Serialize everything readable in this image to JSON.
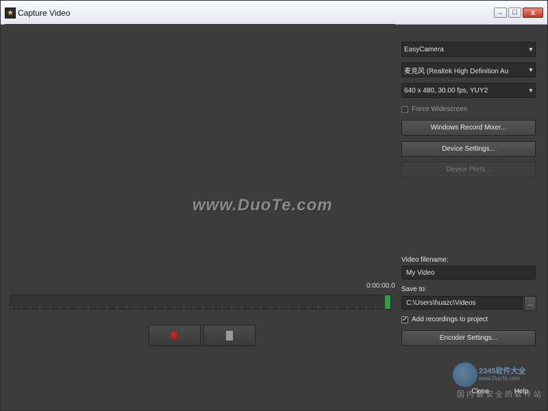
{
  "window": {
    "title": "Capture Video",
    "controls": {
      "minimize": "–",
      "maximize": "☐",
      "close": "X"
    }
  },
  "preview": {
    "watermark": "www.DuoTe.com",
    "timecode": "0:00:00.0"
  },
  "devices": {
    "video_device": "EasyCamera",
    "audio_device": "麦克风 (Realtek High Definition Au",
    "format": "640 x 480, 30.00 fps, YUY2",
    "force_widescreen_label": "Force Widescreen",
    "force_widescreen_checked": false,
    "record_mixer_label": "Windows Record Mixer...",
    "device_settings_label": "Device Settings...",
    "device_ports_label": "Device Ports..."
  },
  "output": {
    "filename_label": "Video filename:",
    "filename_value": "My Video",
    "save_to_label": "Save to:",
    "save_to_value": "C:\\Users\\huazc\\Videos",
    "browse_label": "...",
    "add_to_project_label": "Add recordings to project",
    "add_to_project_checked": true,
    "encoder_settings_label": "Encoder Settings..."
  },
  "footer": {
    "close_label": "Close",
    "help_label": "Help"
  },
  "corner_logo": {
    "title": "2345软件大全",
    "url": "www.DuoTe.com",
    "tagline": "国内最安全的软件站"
  },
  "icons": {
    "app": "star-icon",
    "dropdown": "chevron-down-icon",
    "record": "record-icon",
    "stop": "stop-icon"
  },
  "colors": {
    "record": "#c62828",
    "timeline_marker": "#2ea043"
  }
}
